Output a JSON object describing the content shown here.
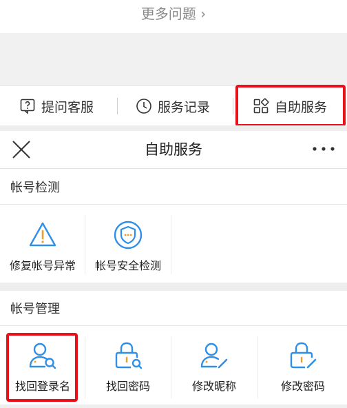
{
  "top": {
    "more_questions": "更多问题 ›"
  },
  "tabs": [
    {
      "label": "提问客服",
      "icon": "question-icon"
    },
    {
      "label": "服务记录",
      "icon": "clock-icon"
    },
    {
      "label": "自助服务",
      "icon": "grid-icon"
    }
  ],
  "header": {
    "title": "自助服务",
    "close_icon": "close-icon",
    "more_icon": "ellipsis-icon"
  },
  "sections": [
    {
      "title": "帐号检测",
      "items": [
        {
          "label": "修复帐号异常",
          "icon": "warning-triangle-icon"
        },
        {
          "label": "帐号安全检测",
          "icon": "shield-icon"
        }
      ]
    },
    {
      "title": "帐号管理",
      "items": [
        {
          "label": "找回登录名",
          "icon": "user-search-icon"
        },
        {
          "label": "找回密码",
          "icon": "lock-search-icon"
        },
        {
          "label": "修改昵称",
          "icon": "user-edit-icon"
        },
        {
          "label": "修改密码",
          "icon": "lock-edit-icon"
        }
      ]
    }
  ],
  "colors": {
    "accent": "#2f8fe6",
    "highlight": "#e8111b",
    "badge": "#f29b2a"
  }
}
